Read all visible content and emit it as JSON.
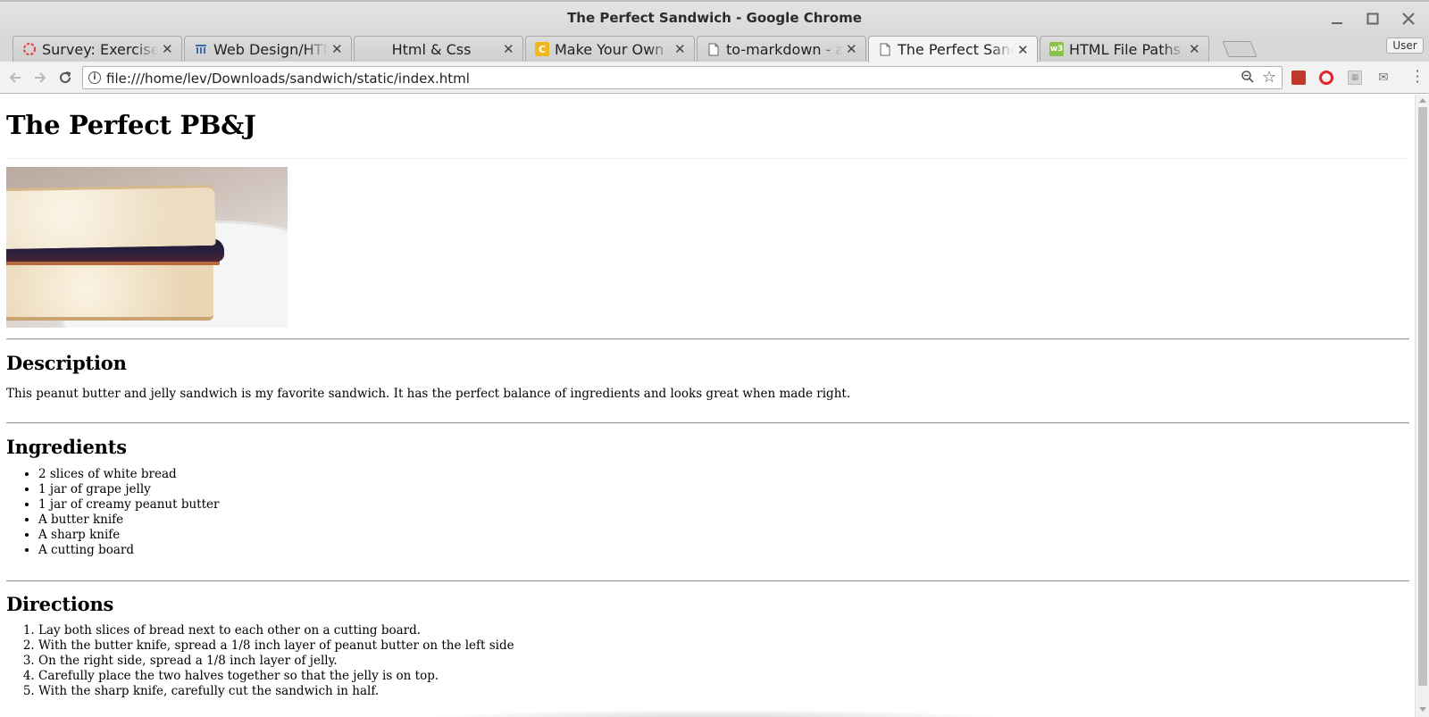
{
  "window": {
    "title": "The Perfect Sandwich - Google Chrome"
  },
  "tabs": [
    {
      "label": "Survey: Exercises",
      "icon": "survey-icon",
      "active": false
    },
    {
      "label": "Web Design/HTML",
      "icon": "web-design-icon",
      "active": false
    },
    {
      "label": "Html & Css",
      "icon": "",
      "active": false
    },
    {
      "label": "Make Your Own M",
      "icon": "codecademy-icon",
      "active": false
    },
    {
      "label": "to-markdown - an",
      "icon": "document-icon",
      "active": false
    },
    {
      "label": "The Perfect Sandwich",
      "icon": "document-icon",
      "active": true
    },
    {
      "label": "HTML File Paths",
      "icon": "w3schools-icon",
      "active": false
    }
  ],
  "profile": {
    "label": "User"
  },
  "address_bar": {
    "url": "file:///home/lev/Downloads/sandwich/static/index.html"
  },
  "page": {
    "title": "The Perfect PB&J",
    "description": {
      "heading": "Description",
      "text": "This peanut butter and jelly sandwich is my favorite sandwich. It has the perfect balance of ingredients and looks great when made right."
    },
    "ingredients": {
      "heading": "Ingredients",
      "items": [
        "2 slices of white bread",
        "1 jar of grape jelly",
        "1 jar of creamy peanut butter",
        "A butter knife",
        "A sharp knife",
        "A cutting board"
      ]
    },
    "directions": {
      "heading": "Directions",
      "items": [
        "Lay both slices of bread next to each other on a cutting board.",
        "With the butter knife, spread a 1/8 inch layer of peanut butter on the left side",
        "On the right side, spread a 1/8 inch layer of jelly.",
        "Carefully place the two halves together so that the jelly is on top.",
        "With the sharp knife, carefully cut the sandwich in half."
      ]
    }
  }
}
